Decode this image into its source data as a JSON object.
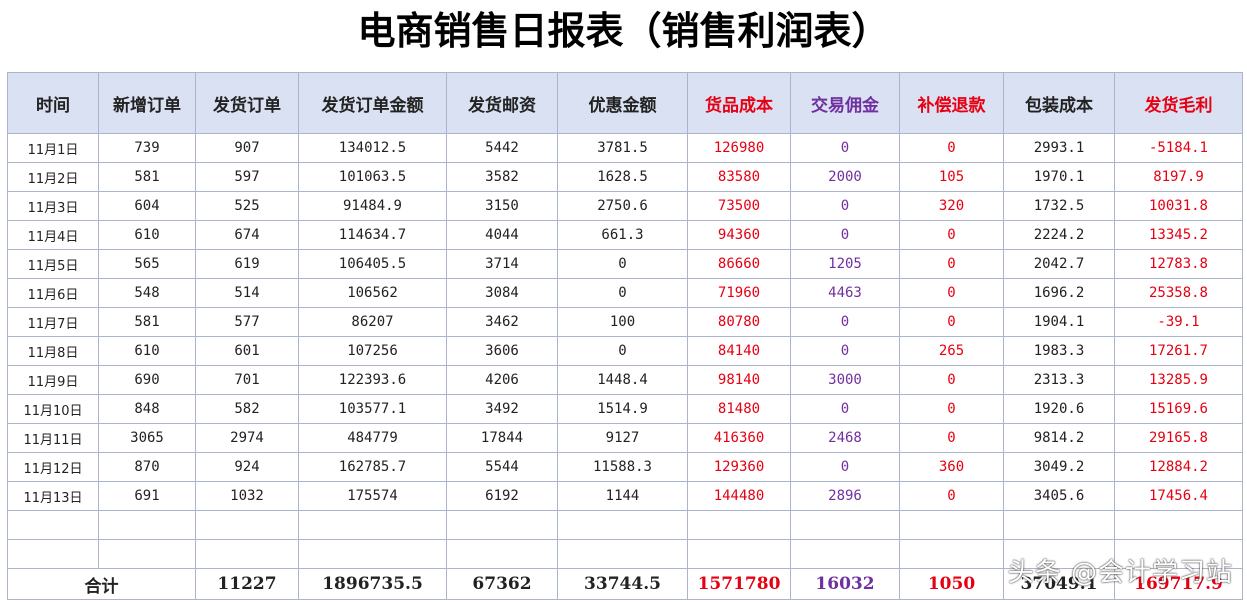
{
  "title": "电商销售日报表（销售利润表）",
  "colors": {
    "header_bg": "#d9e1f2",
    "red": "#e60012",
    "purple": "#7030a0",
    "grid": "#aab4cc"
  },
  "headers": [
    "时间",
    "新增订单",
    "发货订单",
    "发货订单金额",
    "发货邮资",
    "优惠金额",
    "货品成本",
    "交易佣金",
    "补偿退款",
    "包装成本",
    "发货毛利"
  ],
  "rows": [
    [
      "11月1日",
      "739",
      "907",
      "134012.5",
      "5442",
      "3781.5",
      "126980",
      "0",
      "0",
      "2993.1",
      "-5184.1"
    ],
    [
      "11月2日",
      "581",
      "597",
      "101063.5",
      "3582",
      "1628.5",
      "83580",
      "2000",
      "105",
      "1970.1",
      "8197.9"
    ],
    [
      "11月3日",
      "604",
      "525",
      "91484.9",
      "3150",
      "2750.6",
      "73500",
      "0",
      "320",
      "1732.5",
      "10031.8"
    ],
    [
      "11月4日",
      "610",
      "674",
      "114634.7",
      "4044",
      "661.3",
      "94360",
      "0",
      "0",
      "2224.2",
      "13345.2"
    ],
    [
      "11月5日",
      "565",
      "619",
      "106405.5",
      "3714",
      "0",
      "86660",
      "1205",
      "0",
      "2042.7",
      "12783.8"
    ],
    [
      "11月6日",
      "548",
      "514",
      "106562",
      "3084",
      "0",
      "71960",
      "4463",
      "0",
      "1696.2",
      "25358.8"
    ],
    [
      "11月7日",
      "581",
      "577",
      "86207",
      "3462",
      "100",
      "80780",
      "0",
      "0",
      "1904.1",
      "-39.1"
    ],
    [
      "11月8日",
      "610",
      "601",
      "107256",
      "3606",
      "0",
      "84140",
      "0",
      "265",
      "1983.3",
      "17261.7"
    ],
    [
      "11月9日",
      "690",
      "701",
      "122393.6",
      "4206",
      "1448.4",
      "98140",
      "3000",
      "0",
      "2313.3",
      "13285.9"
    ],
    [
      "11月10日",
      "848",
      "582",
      "103577.1",
      "3492",
      "1514.9",
      "81480",
      "0",
      "0",
      "1920.6",
      "15169.6"
    ],
    [
      "11月11日",
      "3065",
      "2974",
      "484779",
      "17844",
      "9127",
      "416360",
      "2468",
      "0",
      "9814.2",
      "29165.8"
    ],
    [
      "11月12日",
      "870",
      "924",
      "162785.7",
      "5544",
      "11588.3",
      "129360",
      "0",
      "360",
      "3049.2",
      "12884.2"
    ],
    [
      "11月13日",
      "691",
      "1032",
      "175574",
      "6192",
      "1144",
      "144480",
      "2896",
      "0",
      "3405.6",
      "17456.4"
    ]
  ],
  "total": [
    "合计",
    "",
    "11227",
    "1896735.5",
    "67362",
    "33744.5",
    "1571780",
    "16032",
    "1050",
    "37049.1",
    "169717.9"
  ],
  "watermark": "头条 @会计学习站"
}
